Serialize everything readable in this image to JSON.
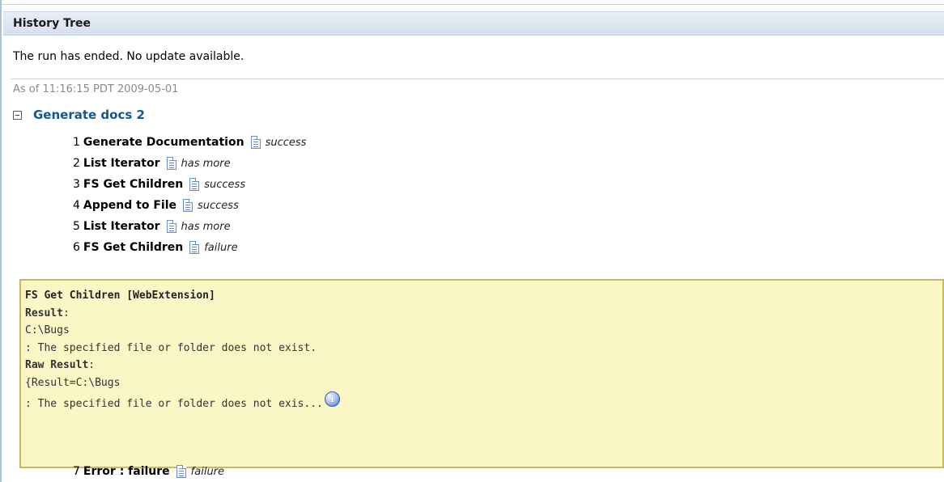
{
  "panel": {
    "title": "History Tree"
  },
  "status": {
    "message": "The run has ended. No update available.",
    "as_of": "As of 11:16:15 PDT 2009-05-01"
  },
  "tree": {
    "root_label": "Generate docs 2",
    "toggle_icon": "collapse-minus-icon",
    "steps": [
      {
        "num": "1",
        "name": "Generate Documentation",
        "icon": "document-icon",
        "status": "success"
      },
      {
        "num": "2",
        "name": "List Iterator",
        "icon": "document-icon",
        "status": "has more"
      },
      {
        "num": "3",
        "name": "FS Get Children",
        "icon": "document-icon",
        "status": "success"
      },
      {
        "num": "4",
        "name": "Append to File",
        "icon": "document-icon",
        "status": "success"
      },
      {
        "num": "5",
        "name": "List Iterator",
        "icon": "document-icon",
        "status": "has more"
      },
      {
        "num": "6",
        "name": "FS Get Children",
        "icon": "document-icon",
        "status": "failure"
      }
    ],
    "after_detail": [
      {
        "num": "7",
        "name": "Error : failure",
        "icon": "document-icon",
        "status": "failure"
      }
    ]
  },
  "detail": {
    "title": "FS Get Children [WebExtension]",
    "result_label": "Result",
    "result_colon": ":",
    "result_line1": "C:\\Bugs",
    "result_line2": ": The specified file or folder does not exist.",
    "raw_label": "Raw Result",
    "raw_colon": ":",
    "raw_line1": "{Result=C:\\Bugs",
    "raw_line2": ": The specified file or folder does not exis...",
    "info_icon": "info-icon",
    "info_glyph": "i"
  },
  "colors": {
    "header_bg": "#d5dfec",
    "root_label": "#14578f",
    "detail_bg": "#fbf6c5",
    "detail_border": "#c8b860"
  }
}
